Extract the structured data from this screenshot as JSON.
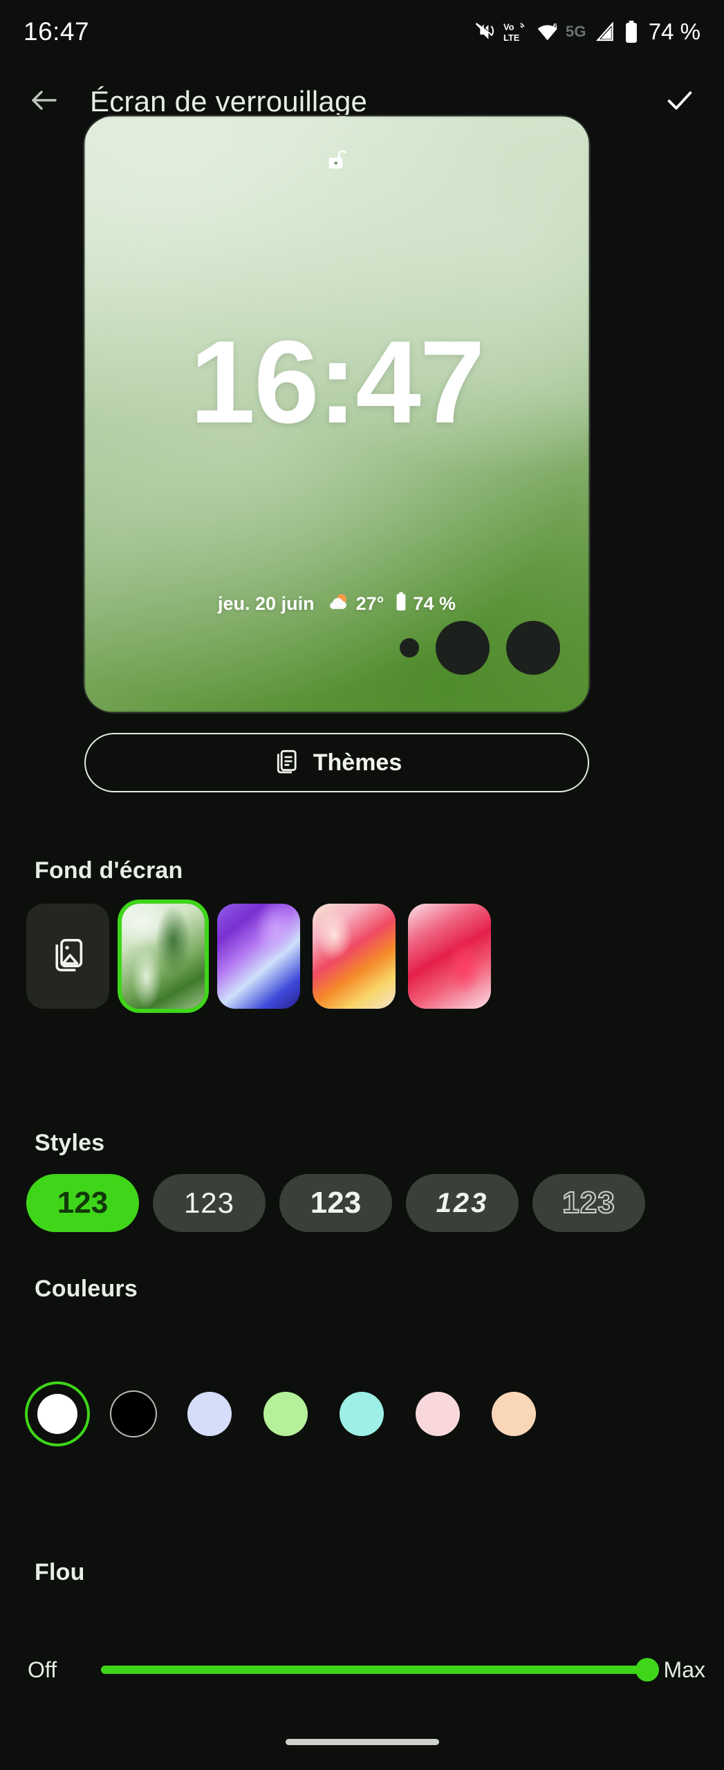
{
  "statusbar": {
    "time": "16:47",
    "network_5g": "5G",
    "battery_text": "74 %",
    "icons": [
      "mute-icon",
      "volte-icon",
      "wifi-icon",
      "signal-icon",
      "battery-icon"
    ]
  },
  "appbar": {
    "back_icon": "back-arrow-icon",
    "title": "Écran de verrouillage",
    "confirm_icon": "check-icon"
  },
  "preview": {
    "lock_icon": "unlocked-padlock-icon",
    "clock": "16:47",
    "date": "jeu. 20 juin",
    "weather_icon": "sun-behind-cloud-icon",
    "temperature": "27°",
    "battery_icon": "battery-icon",
    "battery_text": "74 %",
    "shortcuts": [
      "shortcut-dot-small",
      "shortcut-circle-left",
      "shortcut-circle-right"
    ]
  },
  "themes_button": {
    "icon": "themes-stack-icon",
    "label": "Thèmes"
  },
  "sections": {
    "wallpaper": {
      "title": "Fond d'écran",
      "items": [
        {
          "name": "gallery-picker",
          "kind": "picker",
          "icon": "image-stack-icon",
          "selected": false
        },
        {
          "name": "wallpaper-green",
          "kind": "swatch",
          "class": "w-green",
          "selected": true
        },
        {
          "name": "wallpaper-purple",
          "kind": "swatch",
          "class": "w-purple",
          "selected": false
        },
        {
          "name": "wallpaper-orange",
          "kind": "swatch",
          "class": "w-orange",
          "selected": false
        },
        {
          "name": "wallpaper-red",
          "kind": "swatch",
          "class": "w-red",
          "selected": false
        }
      ]
    },
    "styles": {
      "title": "Styles",
      "items": [
        {
          "label": "123",
          "variant": "sel",
          "selected": true
        },
        {
          "label": "123",
          "variant": "s-cond",
          "selected": false
        },
        {
          "label": "123",
          "variant": "s-bold",
          "selected": false
        },
        {
          "label": "123",
          "variant": "s-ital",
          "selected": false
        },
        {
          "label": "123",
          "variant": "s-outl",
          "selected": false
        }
      ]
    },
    "colors": {
      "title": "Couleurs",
      "items": [
        {
          "name": "color-white",
          "hex": "#ffffff",
          "selected": true,
          "ring": false
        },
        {
          "name": "color-black",
          "hex": "#000000",
          "selected": false,
          "ring": true
        },
        {
          "name": "color-lavender",
          "hex": "#d6ddf9",
          "selected": false,
          "ring": false
        },
        {
          "name": "color-green",
          "hex": "#b5f09a",
          "selected": false,
          "ring": false
        },
        {
          "name": "color-aqua",
          "hex": "#9ef0e6",
          "selected": false,
          "ring": false
        },
        {
          "name": "color-pink",
          "hex": "#f9d8dc",
          "selected": false,
          "ring": false
        },
        {
          "name": "color-peach",
          "hex": "#fad6b8",
          "selected": false,
          "ring": false
        }
      ]
    },
    "blur": {
      "title": "Flou",
      "min_label": "Off",
      "max_label": "Max",
      "value_percent": 100,
      "accent": "#3fd61a"
    }
  },
  "nav": {
    "handle": "home-gesture-handle"
  }
}
